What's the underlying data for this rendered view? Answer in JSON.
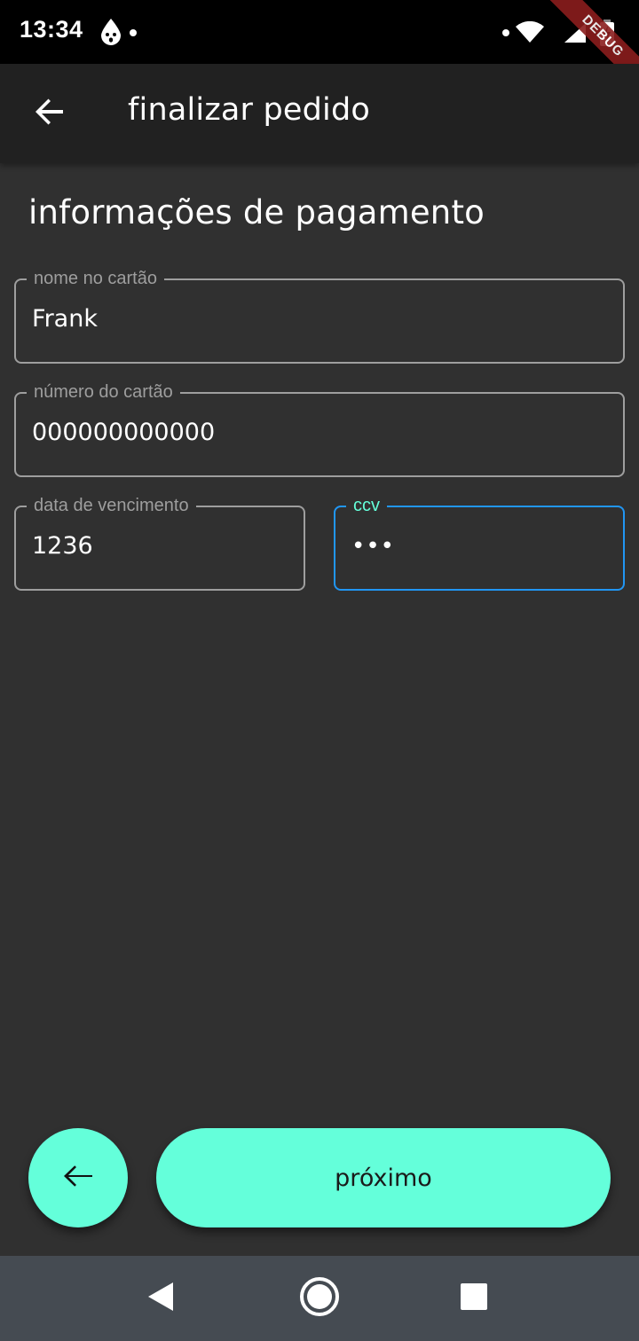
{
  "status_bar": {
    "time": "13:34",
    "debug_banner": "DEBUG",
    "icons": [
      "notification-icon",
      "dot-icon",
      "wifi-icon",
      "signal-icon",
      "battery-charging-icon"
    ]
  },
  "app_bar": {
    "title": "finalizar pedido",
    "back_icon": "arrow-back-icon"
  },
  "section": {
    "heading": "informações de pagamento"
  },
  "form": {
    "card_name": {
      "label": "nome no cartão",
      "value": "Frank"
    },
    "card_number": {
      "label": "número do cartão",
      "value": "000000000000"
    },
    "expiry": {
      "label": "data de vencimento",
      "value": "1236"
    },
    "ccv": {
      "label": "ccv",
      "value": "•••",
      "focused": true
    }
  },
  "actions": {
    "back_icon": "arrow-back-icon",
    "next_label": "próximo"
  },
  "nav_bar": {
    "icons": [
      "nav-back-icon",
      "nav-home-icon",
      "nav-recents-icon"
    ]
  },
  "colors": {
    "accent": "#64ffda",
    "focus_border": "#2196f3",
    "background": "#303030",
    "app_bar": "#212121",
    "nav_bar": "#454b52",
    "debug": "#8b1d1d"
  }
}
